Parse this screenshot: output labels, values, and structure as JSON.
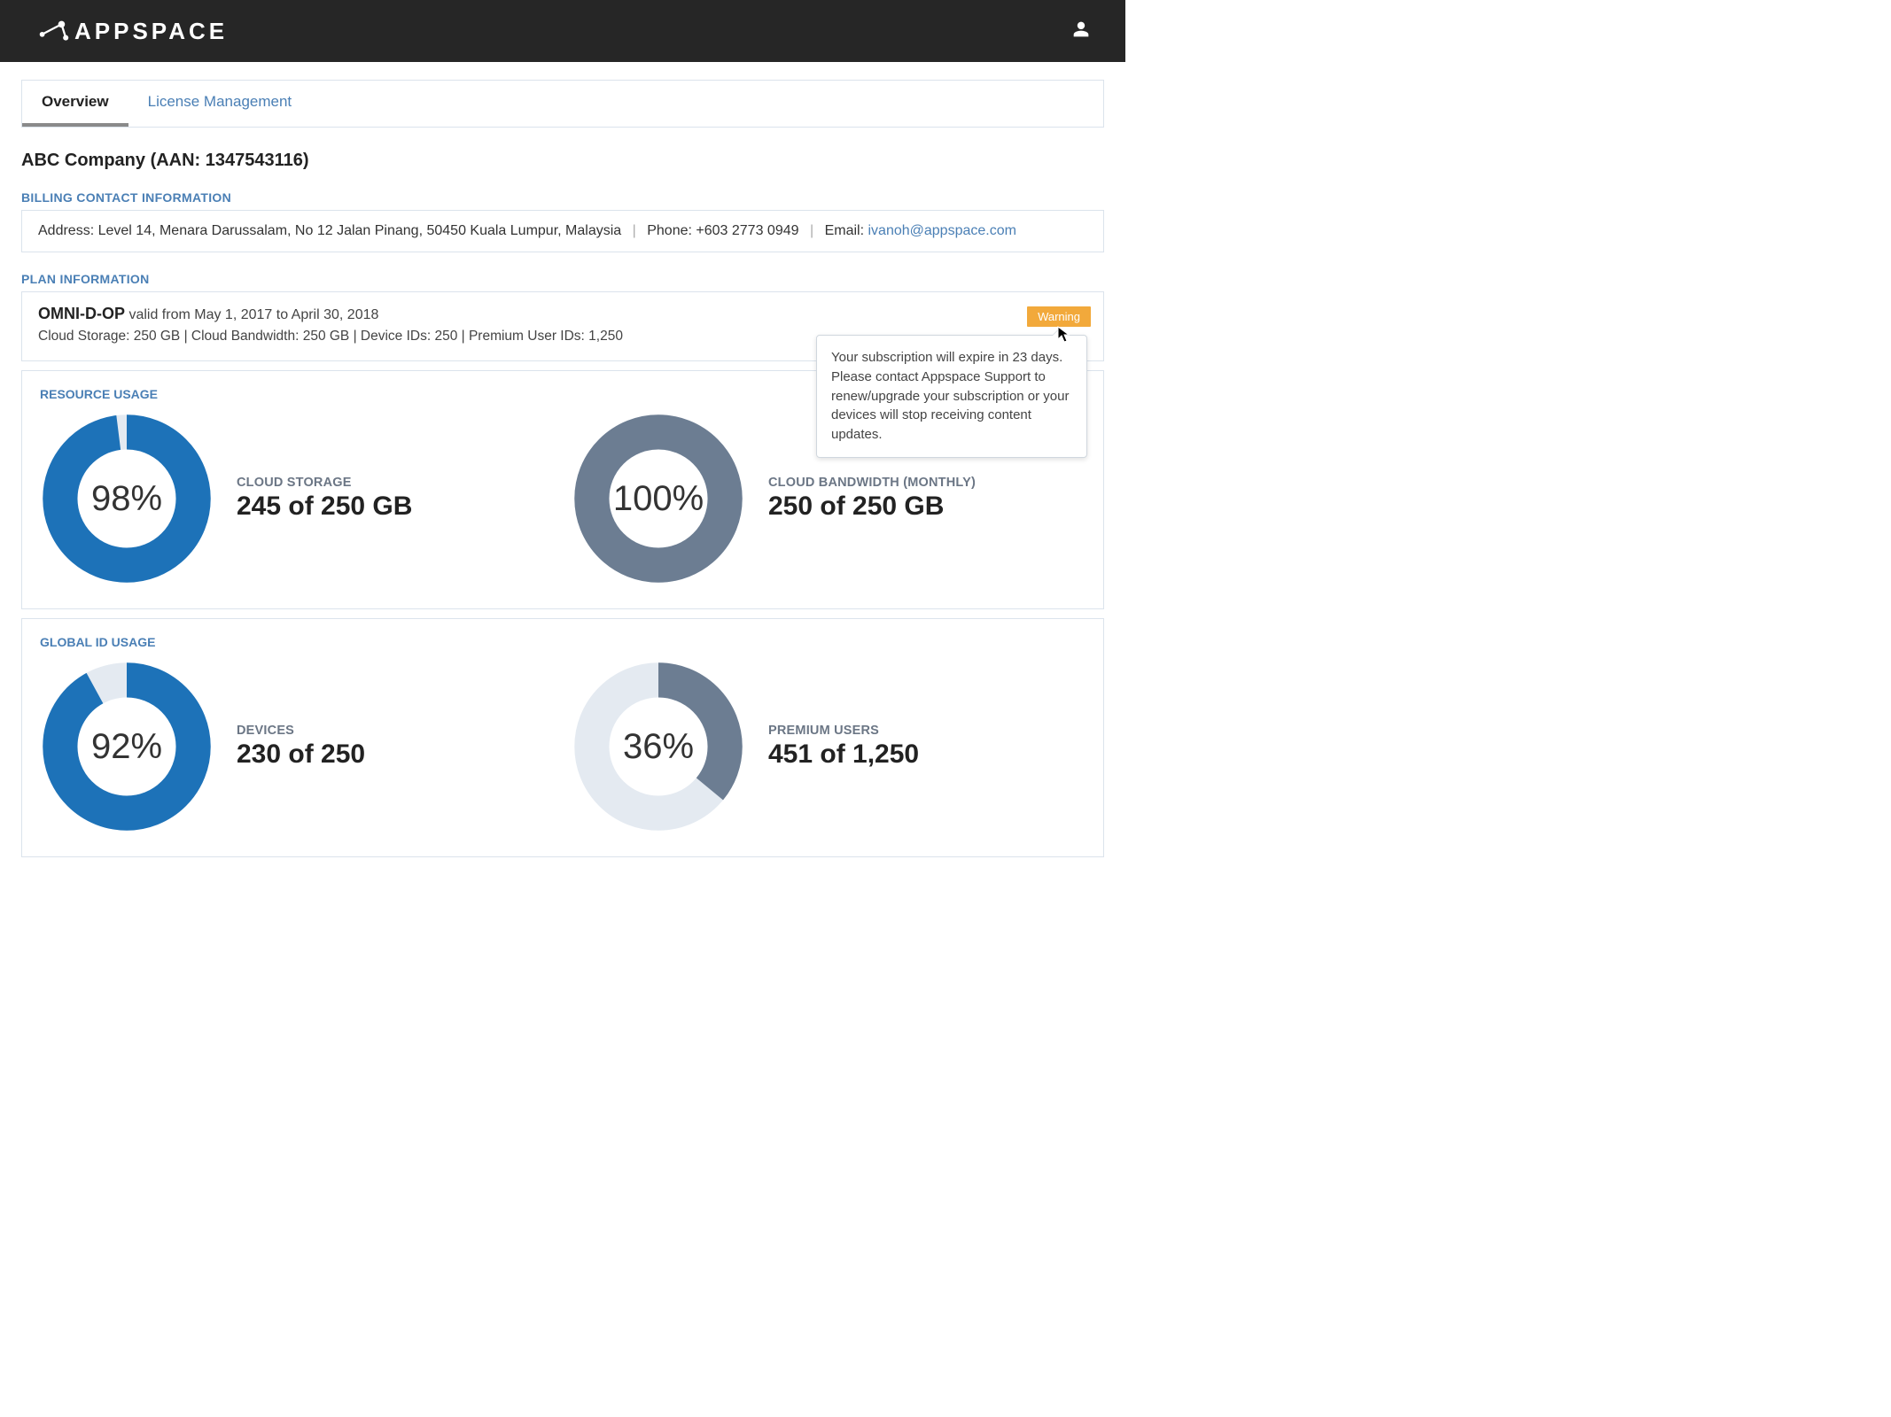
{
  "brand": "APPSPACE",
  "tabs": {
    "overview": "Overview",
    "license": "License Management"
  },
  "company": {
    "title": "ABC Company (AAN: 1347543116)"
  },
  "billing": {
    "section": "BILLING CONTACT INFORMATION",
    "address_label": "Address: ",
    "address": "Level 14, Menara Darussalam, No 12 Jalan Pinang, 50450 Kuala Lumpur, Malaysia",
    "phone_label": "Phone: ",
    "phone": "+603 2773 0949",
    "email_label": "Email: ",
    "email": "ivanoh@appspace.com"
  },
  "plan": {
    "section": "PLAN INFORMATION",
    "name": "OMNI-D-OP",
    "valid": " valid from May 1, 2017 to April 30, 2018",
    "details": "Cloud Storage: 250 GB   |   Cloud Bandwidth: 250 GB   |   Device IDs: 250   |   Premium User IDs: 1,250",
    "warning_label": "Warning",
    "tooltip": "Your subscription will expire in 23 days. Please contact Appspace Support to renew/upgrade your subscription or your devices will stop receiving content updates."
  },
  "resource": {
    "section": "RESOURCE USAGE",
    "storage": {
      "label": "CLOUD STORAGE",
      "value": "245 of 250 GB",
      "pct": "98%"
    },
    "bandwidth": {
      "label": "CLOUD BANDWIDTH (MONTHLY)",
      "value": "250 of 250 GB",
      "pct": "100%"
    }
  },
  "global": {
    "section": "GLOBAL ID USAGE",
    "devices": {
      "label": "DEVICES",
      "value": "230 of 250",
      "pct": "92%"
    },
    "premium": {
      "label": "PREMIUM USERS",
      "value": "451 of 1,250",
      "pct": "36%"
    }
  },
  "chart_data": [
    {
      "type": "pie",
      "title": "Cloud Storage",
      "values": [
        98,
        2
      ],
      "categories": [
        "used",
        "free"
      ],
      "color": "#1d72b8"
    },
    {
      "type": "pie",
      "title": "Cloud Bandwidth (Monthly)",
      "values": [
        100,
        0
      ],
      "categories": [
        "used",
        "free"
      ],
      "color": "#6c7d92"
    },
    {
      "type": "pie",
      "title": "Devices",
      "values": [
        92,
        8
      ],
      "categories": [
        "used",
        "free"
      ],
      "color": "#1d72b8"
    },
    {
      "type": "pie",
      "title": "Premium Users",
      "values": [
        36,
        64
      ],
      "categories": [
        "used",
        "free"
      ],
      "color": "#6c7d92"
    }
  ]
}
